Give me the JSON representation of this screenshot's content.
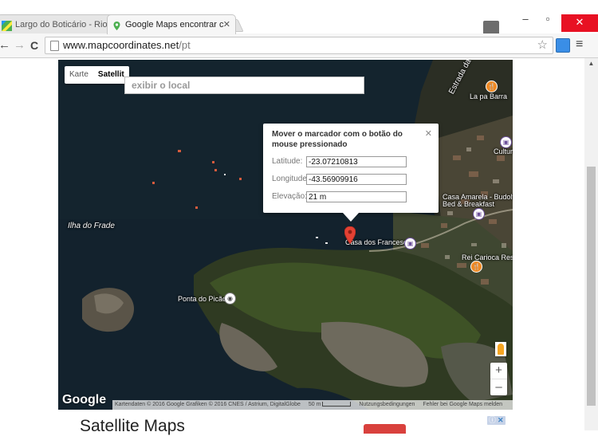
{
  "browser": {
    "tabs": [
      {
        "title": "Largo do Boticário - Rio d",
        "active": false
      },
      {
        "title": "Google Maps encontrar c",
        "active": true
      }
    ],
    "close_glyph": "✕",
    "window_controls": {
      "minimize": "–",
      "maximize": "▫",
      "close": "✕"
    },
    "nav": {
      "back": "←",
      "forward": "→",
      "reload": "C"
    },
    "url_host": "www.mapcoordinates.net",
    "url_path": "/pt",
    "star": "☆",
    "menu": "≡"
  },
  "map": {
    "type_buttons": {
      "map": "Karte",
      "satellite": "Satellit"
    },
    "search_placeholder": "exibir o local",
    "labels": {
      "ilha": "Ilha do Frade",
      "estrada": "Estrada da Barra",
      "la_pa_barra": "La pa Barra",
      "cultura": "Cultura",
      "casa_amarela": "Casa Amarela - Budolfi",
      "bed_breakfast": "Bed & Breakfast",
      "casa_franceses": "Casa dos Franceses",
      "rei_carioca": "Rei Carioca Resta",
      "ponta_picao": "Ponta do Picão"
    },
    "infowindow": {
      "title": "Mover o marcador com o botão do mouse pressionado",
      "close": "✕",
      "latitude_label": "Latitude:",
      "latitude_value": "-23.07210813",
      "longitude_label": "Longitude:",
      "longitude_value": "-43.56909916",
      "elevation_label": "Elevação:",
      "elevation_value": "21 m"
    },
    "zoom_in": "+",
    "zoom_out": "–",
    "logo": "Google",
    "attribution": "Kartendaten © 2016 Google Grafiken © 2016 CNES / Astrium, DigitalGlobe",
    "scale": "50 m",
    "terms": "Nutzungsbedingungen",
    "report": "Fehler bei Google Maps melden"
  },
  "page": {
    "heading": "Satellite Maps",
    "ad_badge": "ⓘ",
    "ad_close": "✕"
  },
  "colors": {
    "water": "#11202c",
    "land_dark": "#2f3a22",
    "land_green": "#3e5226",
    "rock": "#6e6a5d",
    "marker": "#e34133",
    "close_button": "#e81123"
  }
}
